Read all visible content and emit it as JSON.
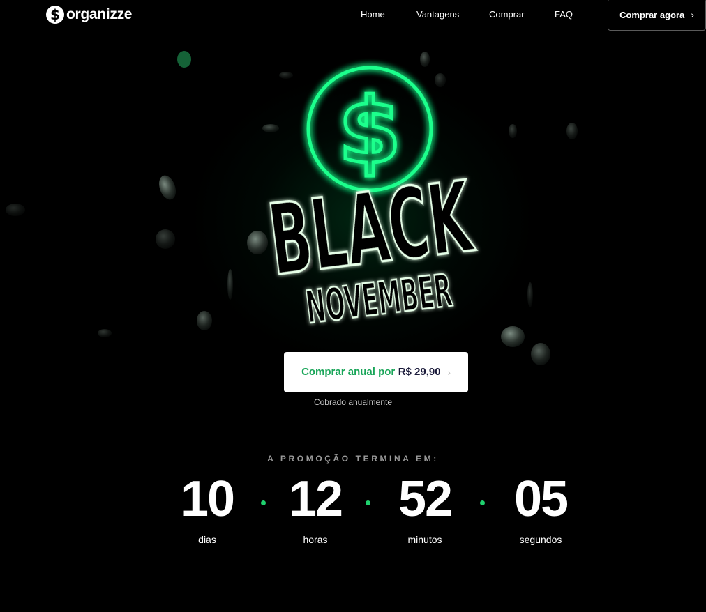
{
  "brand": {
    "name": "organizze",
    "logo_glyph": "$"
  },
  "nav": {
    "items": [
      {
        "id": "home",
        "label": "Home"
      },
      {
        "id": "vantagens",
        "label": "Vantagens"
      },
      {
        "id": "comprar",
        "label": "Comprar"
      },
      {
        "id": "faq",
        "label": "FAQ"
      }
    ],
    "cta_label": "Comprar agora",
    "cta_icon": "chevron-right-icon"
  },
  "hero": {
    "title_line1": "BLACK",
    "title_line2": "NOVEMBER",
    "emblem_glyph": "$",
    "glow_color": "#1aff8c"
  },
  "offer": {
    "button_label": "Comprar anual por",
    "button_price": "R$ 29,90",
    "button_icon": "chevron-right-icon",
    "note": "Cobrado anualmente"
  },
  "countdown": {
    "title": "A PROMOÇÃO TERMINA EM:",
    "units": [
      {
        "value": "10",
        "label": "dias"
      },
      {
        "value": "12",
        "label": "horas"
      },
      {
        "value": "52",
        "label": "minutos"
      },
      {
        "value": "05",
        "label": "segundos"
      }
    ],
    "separator_color": "#1fd16e"
  },
  "colors": {
    "accent": "#18a558",
    "background": "#000000",
    "price_text": "#1a1a3a"
  }
}
